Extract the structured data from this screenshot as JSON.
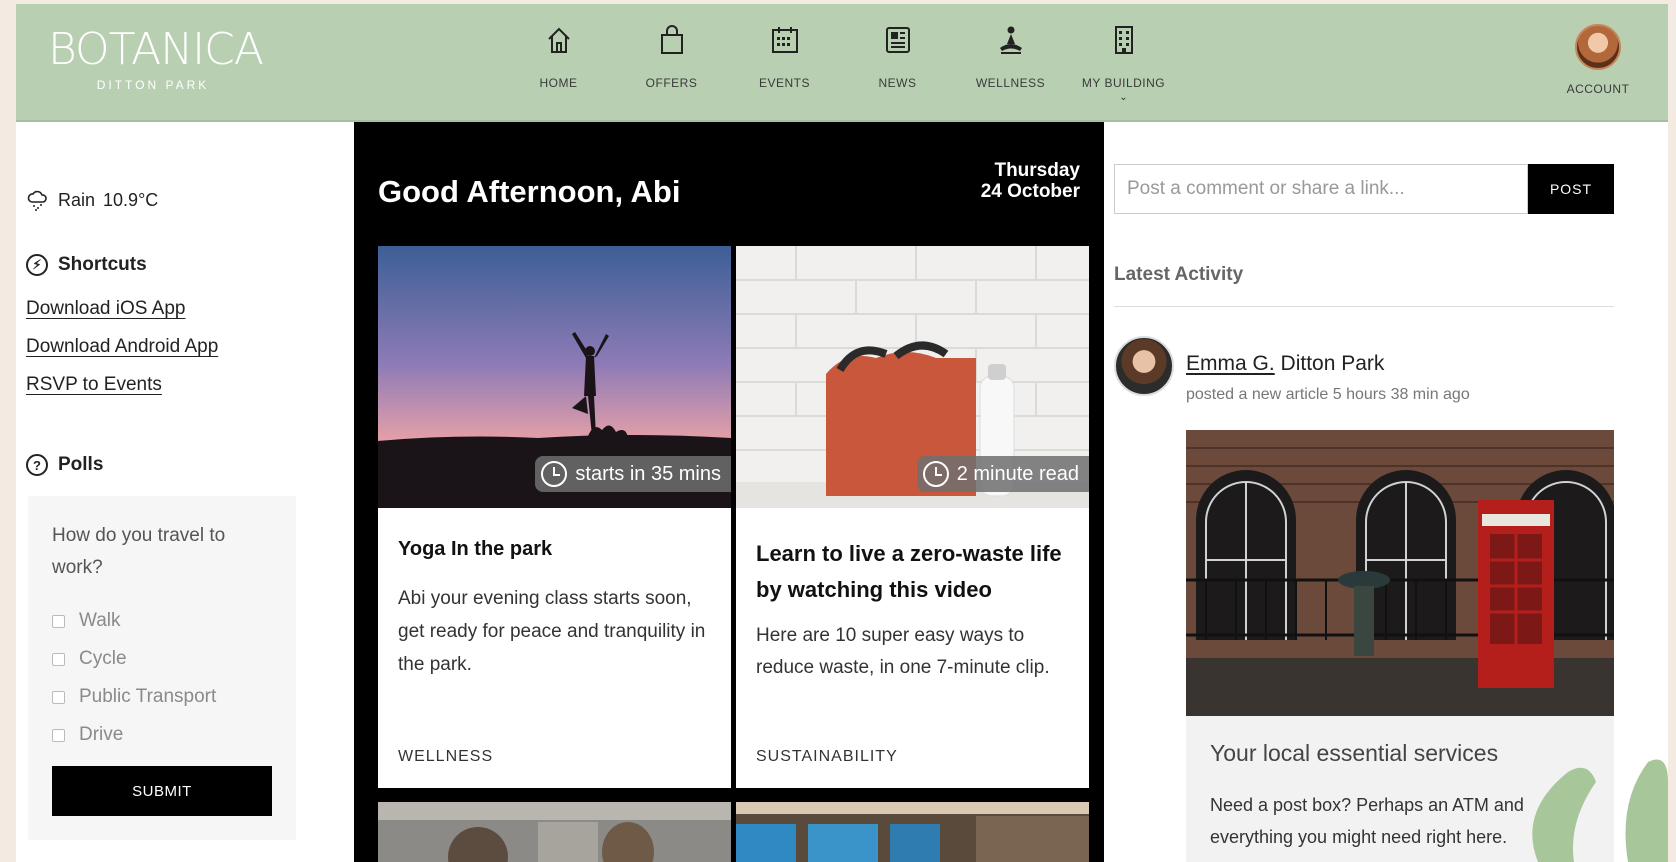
{
  "brand": {
    "name": "BOTANICA",
    "location": "DITTON PARK"
  },
  "nav": [
    {
      "label": "HOME",
      "icon": "home-icon"
    },
    {
      "label": "OFFERS",
      "icon": "bag-icon"
    },
    {
      "label": "EVENTS",
      "icon": "calendar-icon"
    },
    {
      "label": "NEWS",
      "icon": "newspaper-icon"
    },
    {
      "label": "WELLNESS",
      "icon": "meditation-icon"
    },
    {
      "label": "MY BUILDING",
      "icon": "building-icon"
    }
  ],
  "account": {
    "label": "ACCOUNT"
  },
  "weather": {
    "condition": "Rain",
    "temp": "10.9°C"
  },
  "shortcuts": {
    "title": "Shortcuts",
    "links": [
      "Download iOS App",
      "Download Android App",
      "RSVP to Events"
    ]
  },
  "polls": {
    "title": "Polls",
    "question": "How do you travel to work?",
    "options": [
      "Walk",
      "Cycle",
      "Public Transport",
      "Drive"
    ],
    "submit_label": "SUBMIT"
  },
  "greeting": {
    "text": "Good Afternoon, Abi",
    "day": "Thursday",
    "date": "24 October"
  },
  "cards": [
    {
      "badge": "starts in 35 mins",
      "title": "Yoga In the park",
      "body": "Abi your evening class starts soon, get ready for peace and tranquility in the park.",
      "tag": "WELLNESS"
    },
    {
      "badge": "2 minute read",
      "title": "Learn to live a zero-waste life by watching this video",
      "body": "Here are 10 super easy ways to reduce waste, in one 7-minute clip.",
      "tag": "SUSTAINABILITY"
    }
  ],
  "post": {
    "placeholder": "Post a comment or share a link...",
    "button_label": "POST"
  },
  "activity": {
    "title": "Latest Activity",
    "author": "Emma G.",
    "location": "Ditton Park",
    "meta": "posted a new article 5 hours 38 min ago",
    "article_title": "Your local essential services",
    "article_text": "Need a post box? Perhaps an ATM and everything you might need right here."
  },
  "colors": {
    "header_bg": "#b8cfb2",
    "page_bg": "#f3ebe2",
    "accent_dark": "#000000"
  }
}
